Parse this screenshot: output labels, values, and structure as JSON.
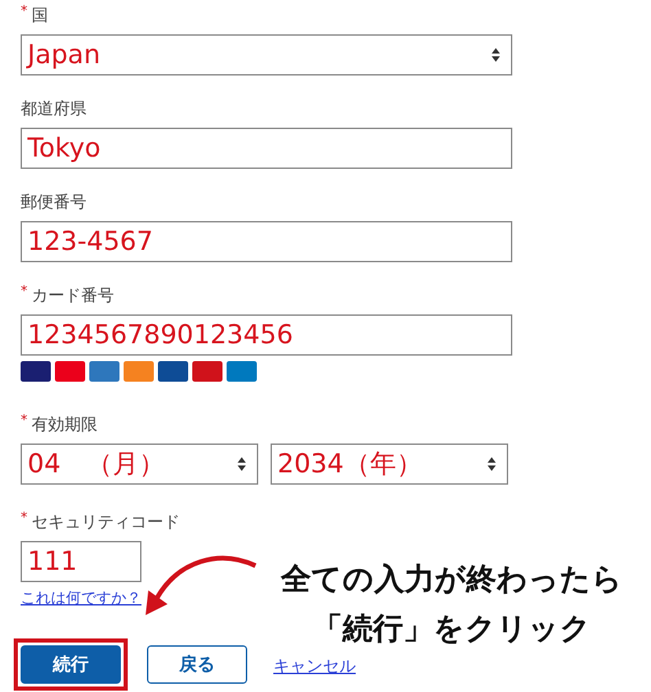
{
  "fields": [
    {
      "kind": "select",
      "label": "国",
      "required_mark": "*",
      "value": "Japan"
    },
    {
      "kind": "text",
      "label": "都道府県",
      "value": "Tokyo"
    },
    {
      "kind": "text",
      "label": "郵便番号",
      "value": "123-4567"
    },
    {
      "kind": "card",
      "label": "カード番号",
      "required_mark": "*",
      "value": "1234567890123456"
    },
    {
      "kind": "expiry",
      "label": "有効期限",
      "required_mark": "*",
      "selects": [
        "04　（月）",
        "2034（年）"
      ]
    },
    {
      "kind": "security",
      "label": "セキュリティコード",
      "required_mark": "*",
      "value": "111",
      "help_link": "これは何ですか？"
    }
  ],
  "card_logos": [
    {
      "color": "#1a1f71"
    },
    {
      "color": "#eb001b"
    },
    {
      "color": "#2e77bc"
    },
    {
      "color": "#f58220"
    },
    {
      "color": "#0e4c96"
    },
    {
      "color": "#d0121b"
    },
    {
      "color": "#0079be"
    }
  ],
  "buttons": [
    {
      "kind": "primary",
      "label": "続行",
      "highlighted": true
    },
    {
      "kind": "secondary",
      "label": "戻る",
      "highlighted": false
    },
    {
      "kind": "link",
      "label": "キャンセル",
      "highlighted": false
    }
  ],
  "annotation": {
    "lines": [
      "全ての入力が終わったら",
      "「続行」をクリック"
    ]
  }
}
